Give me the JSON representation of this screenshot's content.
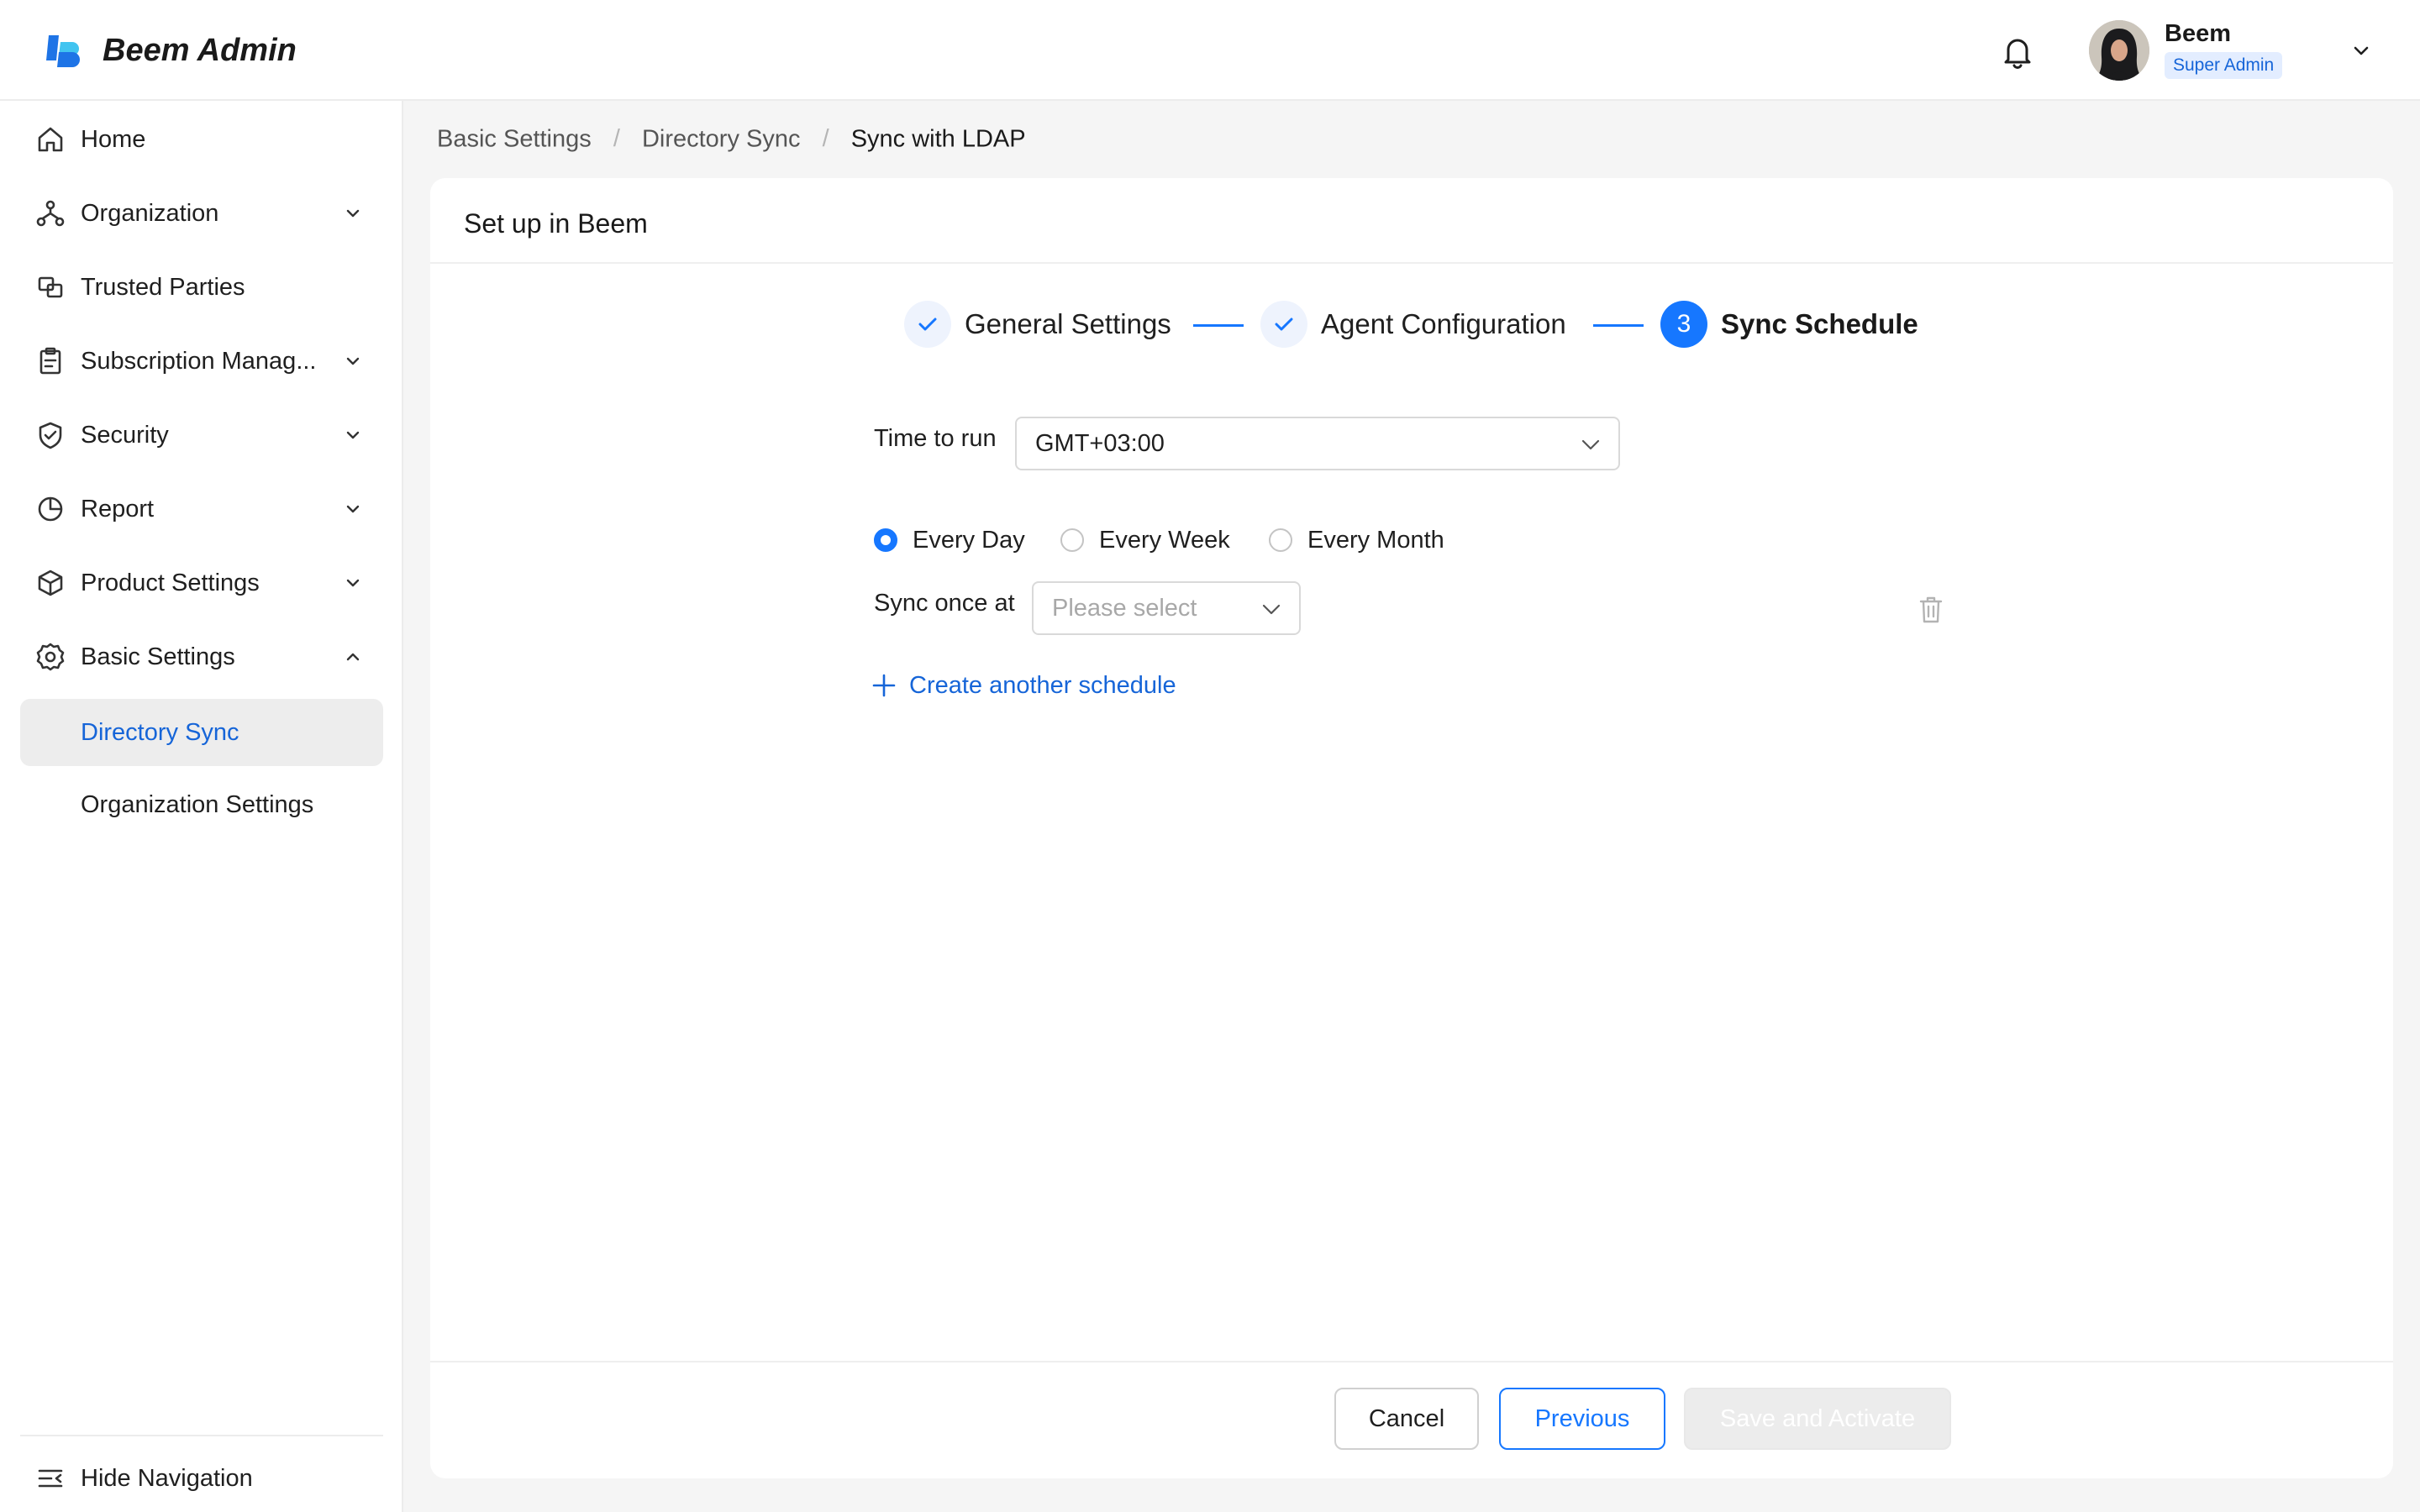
{
  "header": {
    "app_title": "Beem Admin",
    "user": {
      "name": "Beem",
      "role": "Super Admin"
    },
    "icons": {
      "logo": "beem-logo",
      "notifications": "bell-icon",
      "menu": "chevron-down-icon"
    }
  },
  "sidebar": {
    "items": [
      {
        "label": "Home",
        "icon": "home-icon",
        "expandable": false
      },
      {
        "label": "Organization",
        "icon": "org-chart-icon",
        "expandable": true,
        "expanded": false
      },
      {
        "label": "Trusted Parties",
        "icon": "linked-squares-icon",
        "expandable": false
      },
      {
        "label": "Subscription Manag...",
        "icon": "clipboard-icon",
        "expandable": true,
        "expanded": false
      },
      {
        "label": "Security",
        "icon": "shield-icon",
        "expandable": true,
        "expanded": false
      },
      {
        "label": "Report",
        "icon": "pie-chart-icon",
        "expandable": true,
        "expanded": false
      },
      {
        "label": "Product Settings",
        "icon": "box-icon",
        "expandable": true,
        "expanded": false
      },
      {
        "label": "Basic Settings",
        "icon": "gear-icon",
        "expandable": true,
        "expanded": true
      }
    ],
    "sub_items": [
      {
        "label": "Directory Sync",
        "active": true
      },
      {
        "label": "Organization Settings",
        "active": false
      }
    ],
    "hide_nav_label": "Hide Navigation"
  },
  "breadcrumb": {
    "items": [
      "Basic Settings",
      "Directory Sync"
    ],
    "current": "Sync with LDAP"
  },
  "card": {
    "title": "Set up in Beem",
    "steps": [
      {
        "label": "General Settings",
        "status": "done"
      },
      {
        "label": "Agent Configuration",
        "status": "done"
      },
      {
        "label": "Sync Schedule",
        "status": "active",
        "number": "3"
      }
    ],
    "time_to_run": {
      "label": "Time to run",
      "value": "GMT+03:00"
    },
    "frequency": {
      "options": [
        "Every Day",
        "Every Week",
        "Every Month"
      ],
      "selected": "Every Day"
    },
    "sync_once": {
      "label": "Sync once at",
      "placeholder": "Please select"
    },
    "add_schedule_label": "Create another schedule",
    "buttons": {
      "cancel": "Cancel",
      "previous": "Previous",
      "save": "Save and Activate"
    }
  },
  "colors": {
    "accent": "#1677ff",
    "link": "#1665d8",
    "active_bg": "#ededed",
    "page_bg": "#f5f5f5"
  }
}
